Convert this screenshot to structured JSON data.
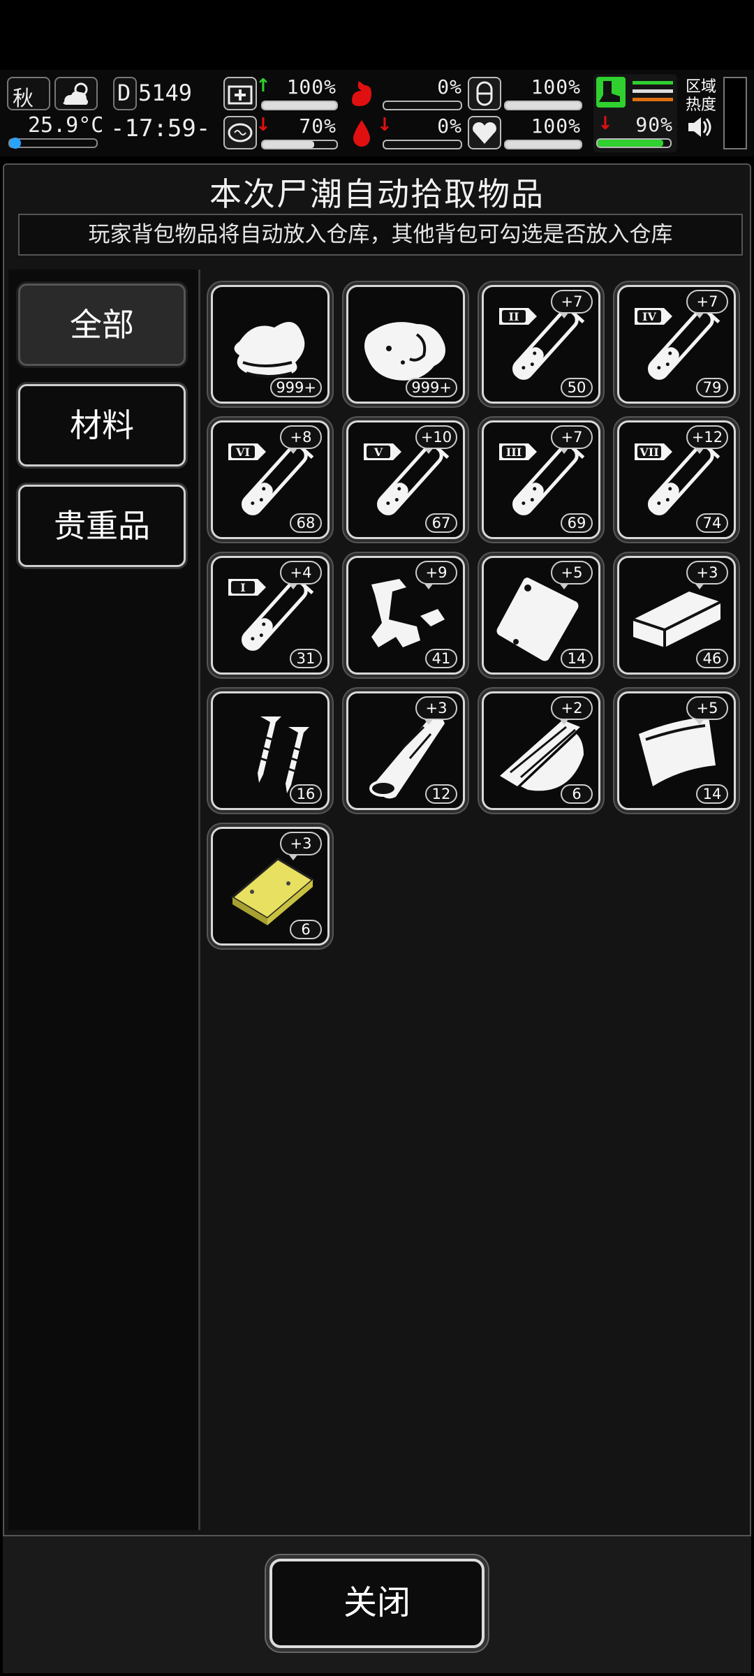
{
  "status": {
    "season": "秋",
    "day": "D5149",
    "temperature": "25.9°C",
    "time": "-17:59-",
    "zone_heat": "区域\n热度",
    "stats": {
      "health": "100%",
      "hunger": "0%",
      "stamina": "100%",
      "mental": "70%",
      "bleeding": "0%",
      "mood": "100%",
      "infection": "90%"
    },
    "levels": {
      "health": 1.0,
      "hunger": 0.0,
      "stamina": 1.0,
      "mental": 0.7,
      "bleeding": 0.0,
      "mood": 1.0,
      "infection": 0.9
    }
  },
  "panel": {
    "title": "本次尸潮自动拾取物品",
    "subtitle": "玩家背包物品将自动放入仓库，其他背包可勾选是否放入仓库"
  },
  "categories": [
    {
      "label": "全部",
      "active": true
    },
    {
      "label": "材料",
      "active": false
    },
    {
      "label": "贵重品",
      "active": false
    }
  ],
  "items": [
    {
      "name": "cloth",
      "qty": "999+",
      "bonus": ""
    },
    {
      "name": "meat",
      "qty": "999+",
      "bonus": ""
    },
    {
      "name": "test-tube-II",
      "qty": "50",
      "bonus": "+7",
      "tier": "II"
    },
    {
      "name": "test-tube-IV",
      "qty": "79",
      "bonus": "+7",
      "tier": "IV"
    },
    {
      "name": "test-tube-VI",
      "qty": "68",
      "bonus": "+8",
      "tier": "VI"
    },
    {
      "name": "test-tube-V",
      "qty": "67",
      "bonus": "+10",
      "tier": "V"
    },
    {
      "name": "test-tube-III",
      "qty": "69",
      "bonus": "+7",
      "tier": "III"
    },
    {
      "name": "test-tube-VII",
      "qty": "74",
      "bonus": "+12",
      "tier": "VII"
    },
    {
      "name": "test-tube-I",
      "qty": "31",
      "bonus": "+4",
      "tier": "I"
    },
    {
      "name": "scrap-metal",
      "qty": "41",
      "bonus": "+9"
    },
    {
      "name": "plastic-bag",
      "qty": "14",
      "bonus": "+5"
    },
    {
      "name": "brick",
      "qty": "46",
      "bonus": "+3"
    },
    {
      "name": "screws",
      "qty": "16",
      "bonus": ""
    },
    {
      "name": "wood-log",
      "qty": "12",
      "bonus": "+3"
    },
    {
      "name": "wood-planks",
      "qty": "6",
      "bonus": "+2"
    },
    {
      "name": "leather-sheet",
      "qty": "14",
      "bonus": "+5"
    },
    {
      "name": "gold-bar",
      "qty": "6",
      "bonus": "+3"
    }
  ],
  "footer": {
    "close_label": "关闭"
  },
  "colors": {
    "infection_green": "#2fd02f",
    "blood_red": "#e01010",
    "gold": "#e8e060"
  }
}
